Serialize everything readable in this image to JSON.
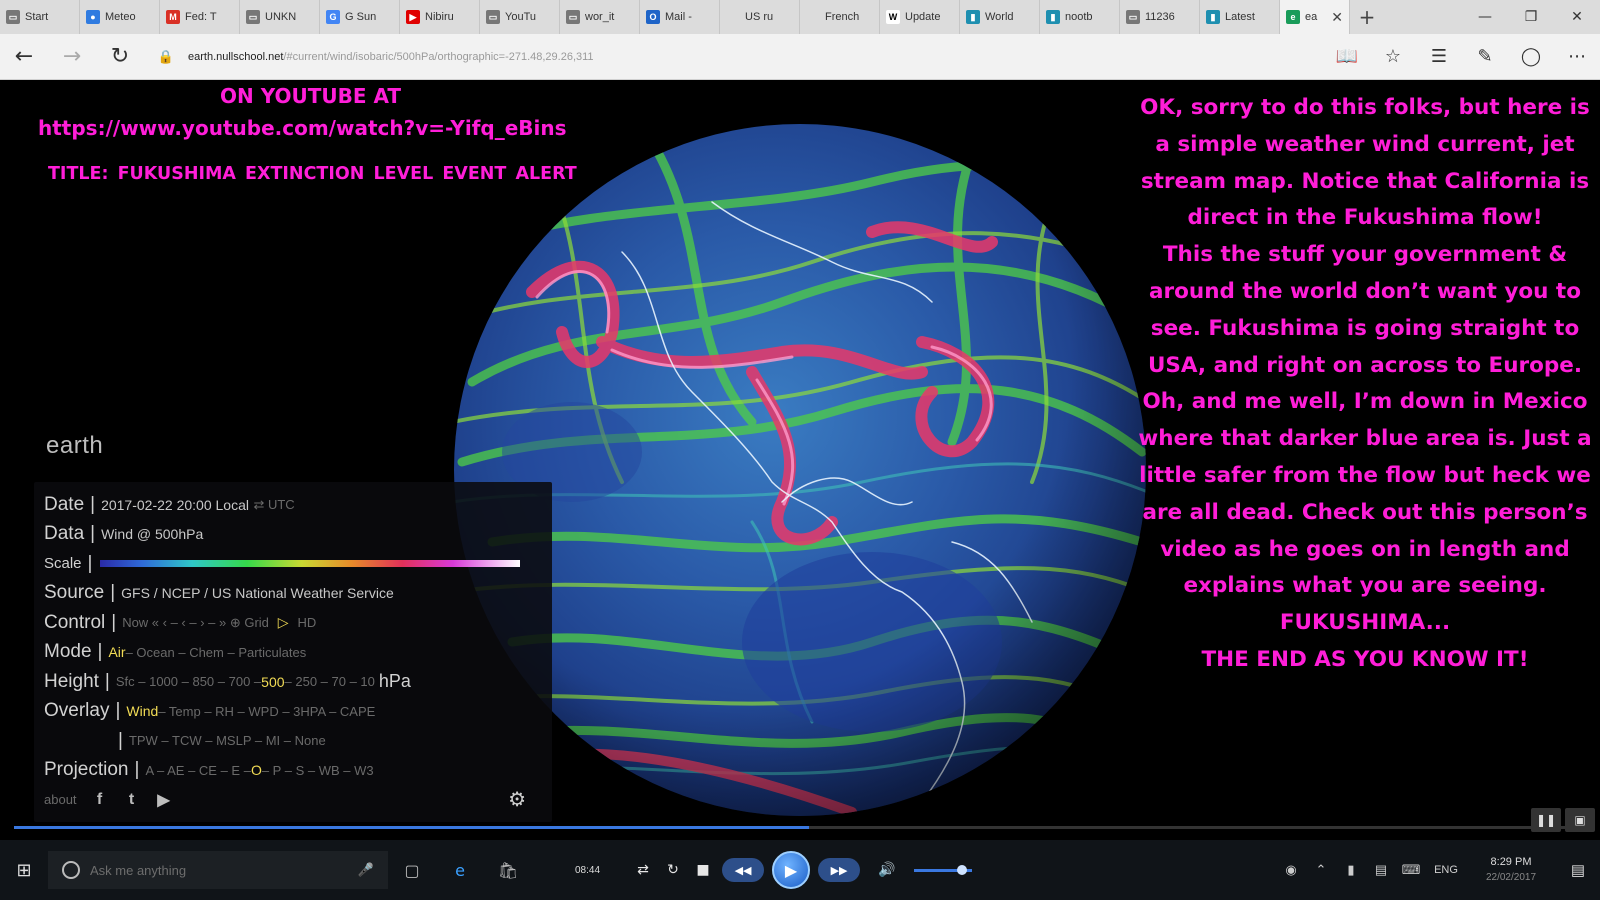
{
  "browser": {
    "tabs": [
      {
        "label": "Start",
        "icon": "page-icon",
        "color": "#777777"
      },
      {
        "label": "Meteo",
        "icon": "globe-icon",
        "color": "#2f7be0"
      },
      {
        "label": "Fed: T",
        "icon": "gmail-icon",
        "color": "#d93025"
      },
      {
        "label": "UNKN",
        "icon": "page-icon",
        "color": "#777777"
      },
      {
        "label": "G Sun",
        "icon": "google-icon",
        "color": "#4285f4"
      },
      {
        "label": "Nibiru",
        "icon": "youtube-icon",
        "color": "#e00000"
      },
      {
        "label": "YouTu",
        "icon": "page-icon",
        "color": "#777777"
      },
      {
        "label": "wor_it",
        "icon": "page-icon",
        "color": "#777777"
      },
      {
        "label": "Mail -",
        "icon": "outlook-icon",
        "color": "#1e64c8"
      },
      {
        "label": "US ru",
        "icon": "blank-icon",
        "color": "#dcdcdc"
      },
      {
        "label": "French",
        "icon": "blank-icon",
        "color": "#dcdcdc"
      },
      {
        "label": "Update",
        "icon": "wikipedia-icon",
        "color": "#ffffff"
      },
      {
        "label": "World",
        "icon": "bookmark-icon",
        "color": "#1e8fb0"
      },
      {
        "label": "nootb",
        "icon": "bookmark-icon",
        "color": "#1e8fb0"
      },
      {
        "label": "11236",
        "icon": "page-icon",
        "color": "#777777"
      },
      {
        "label": "Latest",
        "icon": "bookmark-icon",
        "color": "#1e8fb0"
      }
    ],
    "active_tab": {
      "label": "ea",
      "icon": "earth-icon",
      "color": "#1a9c5a",
      "close": "✕"
    },
    "new_tab": "+",
    "window": {
      "minimize": "—",
      "restore": "❐",
      "close": "✕"
    },
    "url_host": "earth.nullschool.net",
    "url_rest": "/#current/wind/isobaric/500hPa/orthographic=-271.48,29.26,311"
  },
  "overlay": {
    "youtube_line1": "ON YOUTUBE AT",
    "youtube_url": "https://www.youtube.com/watch?v=-Yifq_eBins",
    "title_line": "TITLE: FUKUSHIMA    EXTINCTION LEVEL EVENT  ALERT",
    "message": [
      "OK, sorry to do this folks, but here is a simple weather wind current, jet stream map. Notice that California is direct in the Fukushima flow!",
      "This the stuff your government & around the world don’t want you to see. Fukushima is going straight to USA, and right on across to Europe.",
      "Oh, and me well, I’m down in Mexico where that darker blue area is. Just a little safer from the flow but heck we are all dead.  Check out this person’s video as he goes on in length and explains what you are seeing.",
      "FUKUSHIMA...",
      "THE END AS YOU KNOW IT!"
    ],
    "text_color": "#ff1ed8"
  },
  "earth": {
    "logo": "earth",
    "date_label": "Date",
    "date_value": "2017-02-22 20:00 Local",
    "date_utc": "⇄ UTC",
    "data_label": "Data",
    "data_value": "Wind @ 500hPa",
    "scale_label": "Scale",
    "source_label": "Source",
    "source_value": "GFS / NCEP / US National Weather Service",
    "control_label": "Control",
    "control_value": "Now  «  ‹  –  ‹  –  ›  –  »    ⊕    Grid",
    "control_play": "▷",
    "control_hd": "HD",
    "mode_label": "Mode",
    "mode_selected": "Air",
    "mode_rest": " – Ocean – Chem – Particulates",
    "height_label": "Height",
    "height_before": "Sfc – 1000 – 850 – 700 – ",
    "height_selected": "500",
    "height_after": " – 250 – 70 – 10",
    "height_unit": "hPa",
    "overlay_label": "Overlay",
    "overlay_selected": "Wind",
    "overlay_rest": " – Temp – RH – WPD – 3HPA – CAPE",
    "overlay_line2": "TPW – TCW – MSLP – MI – None",
    "projection_label": "Projection",
    "projection_before": "A – AE – CE – E – ",
    "projection_selected": "O",
    "projection_after": " – P – S – WB – W3",
    "about": "about",
    "social": [
      "f",
      "t",
      "▶"
    ],
    "gear": "⚙"
  },
  "player": {
    "progress": 0.506,
    "current_time": "08:44",
    "buttons": {
      "rewind": "◀◀",
      "play": "▶",
      "forward": "▶▶",
      "stop": "■",
      "repeat": "↻",
      "shuffle": "⇄",
      "volume": "🔊"
    },
    "volume": 0.82,
    "mini": [
      "❚❚",
      "▣"
    ]
  },
  "taskbar": {
    "start": "⊞",
    "search_placeholder": "Ask me anything",
    "lang": "ENG",
    "time": "8:29 PM",
    "date": "22/02/2017",
    "notify": "▤"
  }
}
